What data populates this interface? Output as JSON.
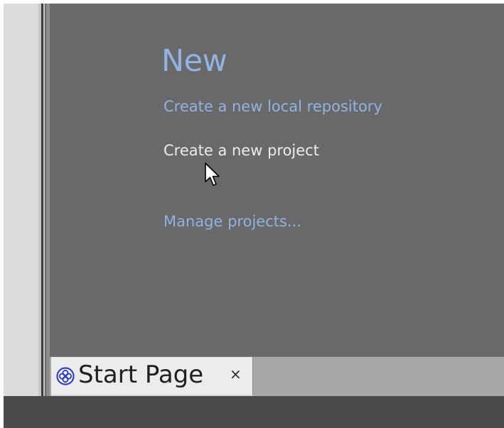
{
  "start_page": {
    "section_heading": "New",
    "links": [
      {
        "label": "Create a new local repository"
      },
      {
        "label": "Create a new project"
      },
      {
        "label": "Manage projects..."
      }
    ]
  },
  "tabs": [
    {
      "label": "Start Page",
      "close": "×",
      "icon": "start-page-icon"
    }
  ],
  "colors": {
    "content_bg": "#696969",
    "link_blue": "#8fb3e3",
    "link_hover": "#ececec",
    "tab_active_bg": "#ececec",
    "tab_strip_bg": "#a8a8a8",
    "status_bar": "#4a4a4a"
  }
}
